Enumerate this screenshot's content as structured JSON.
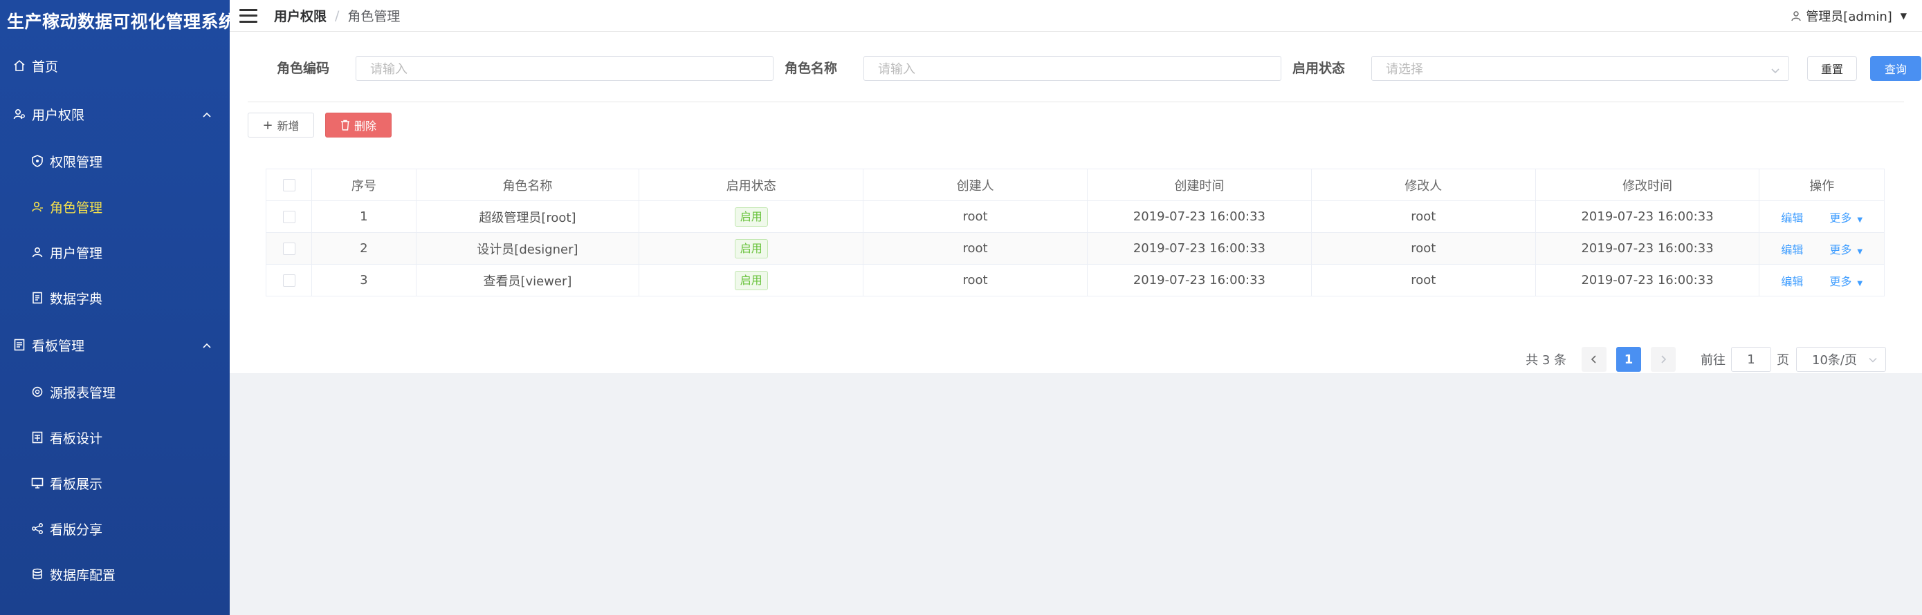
{
  "app": {
    "title": "生产稼动数据可视化管理系统"
  },
  "sidebar": {
    "items": [
      {
        "label": "首页",
        "icon": "home-icon"
      },
      {
        "label": "用户权限",
        "icon": "user-group-icon",
        "expanded": true
      },
      {
        "label": "权限管理",
        "icon": "shield-icon"
      },
      {
        "label": "角色管理",
        "icon": "role-icon",
        "active": true
      },
      {
        "label": "用户管理",
        "icon": "user-icon"
      },
      {
        "label": "数据字典",
        "icon": "dictionary-icon"
      },
      {
        "label": "看板管理",
        "icon": "board-icon",
        "expanded": true
      },
      {
        "label": "源报表管理",
        "icon": "report-source-icon"
      },
      {
        "label": "看板设计",
        "icon": "board-design-icon"
      },
      {
        "label": "看板展示",
        "icon": "board-display-icon"
      },
      {
        "label": "看版分享",
        "icon": "share-icon"
      },
      {
        "label": "数据库配置",
        "icon": "database-icon"
      }
    ]
  },
  "header": {
    "breadcrumb": [
      "用户权限",
      "角色管理"
    ],
    "breadcrumb_sep": "/",
    "user": "管理员[admin]"
  },
  "search": {
    "role_code_label": "角色编码",
    "role_code_placeholder": "请输入",
    "role_name_label": "角色名称",
    "role_name_placeholder": "请输入",
    "status_label": "启用状态",
    "status_placeholder": "请选择",
    "reset_label": "重置",
    "query_label": "查询"
  },
  "toolbar": {
    "add_label": "新增",
    "delete_label": "删除"
  },
  "table": {
    "columns": [
      "序号",
      "角色名称",
      "启用状态",
      "创建人",
      "创建时间",
      "修改人",
      "修改时间",
      "操作"
    ],
    "rows": [
      {
        "index": "1",
        "name": "超级管理员[root]",
        "status": "启用",
        "creator": "root",
        "created": "2019-07-23 16:00:33",
        "modifier": "root",
        "modified": "2019-07-23 16:00:33",
        "edit": "编辑",
        "more": "更多"
      },
      {
        "index": "2",
        "name": "设计员[designer]",
        "status": "启用",
        "creator": "root",
        "created": "2019-07-23 16:00:33",
        "modifier": "root",
        "modified": "2019-07-23 16:00:33",
        "edit": "编辑",
        "more": "更多"
      },
      {
        "index": "3",
        "name": "查看员[viewer]",
        "status": "启用",
        "creator": "root",
        "created": "2019-07-23 16:00:33",
        "modifier": "root",
        "modified": "2019-07-23 16:00:33",
        "edit": "编辑",
        "more": "更多"
      }
    ]
  },
  "pager": {
    "total": "共 3 条",
    "current": "1",
    "goto_prefix": "前往",
    "goto_value": "1",
    "goto_suffix": "页",
    "page_size": "10条/页"
  },
  "colors": {
    "sidebar": "#1e4aa0",
    "active": "#f7e24b",
    "primary": "#4a90f2",
    "danger": "#ec6a6a",
    "success": "#67c23a"
  }
}
